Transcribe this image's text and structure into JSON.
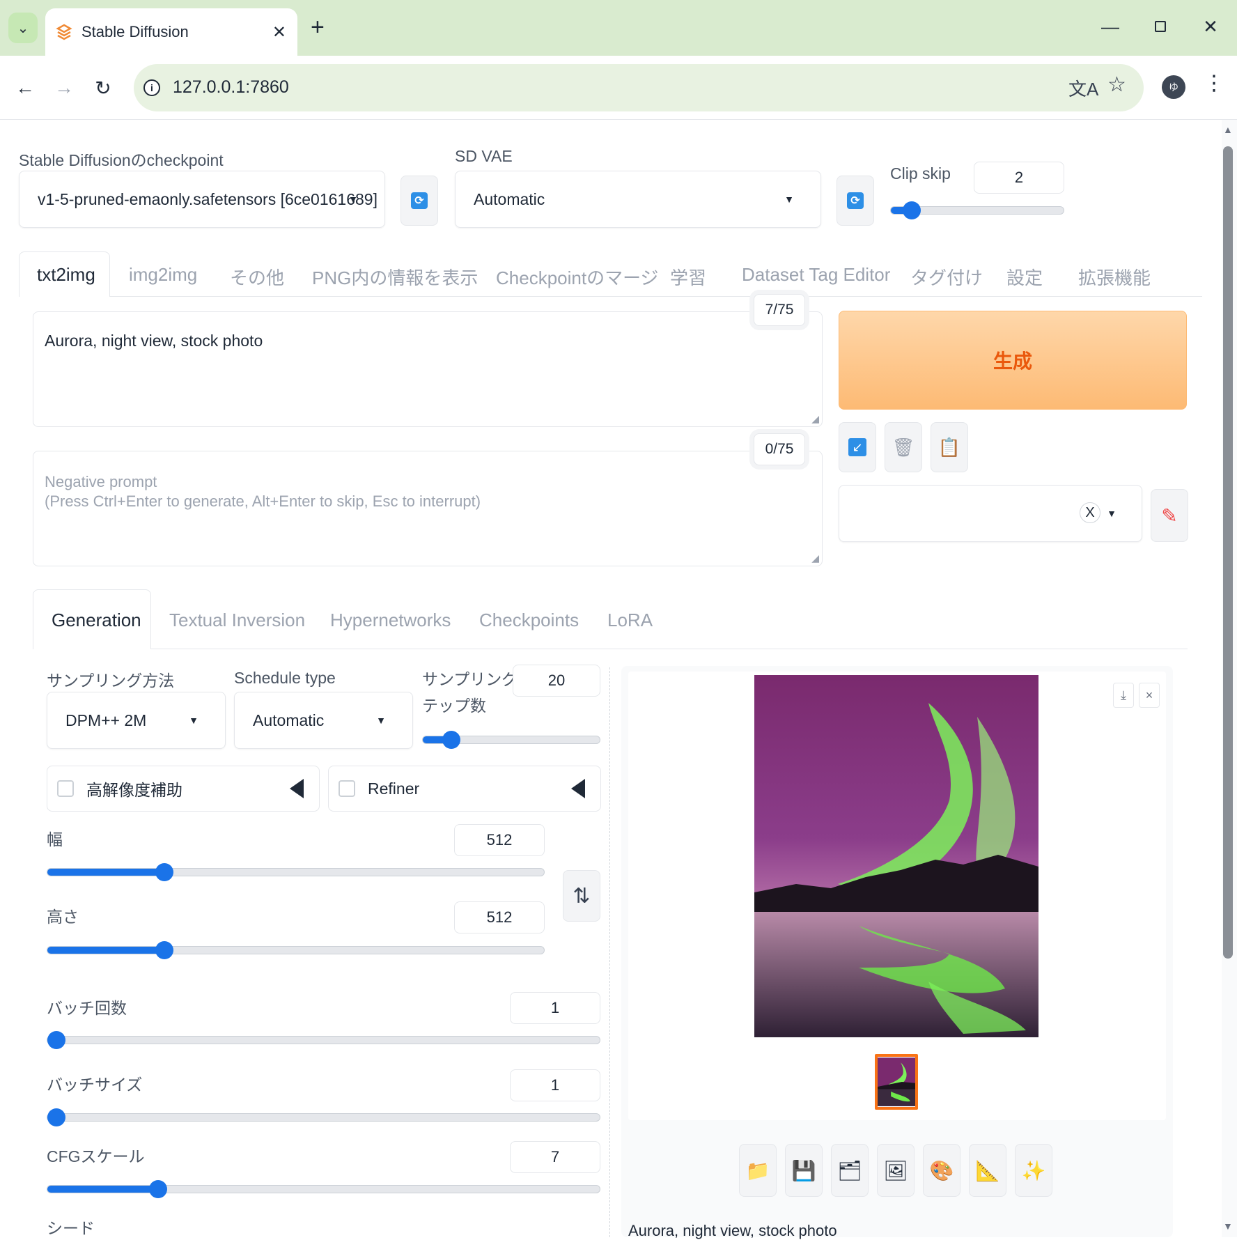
{
  "browser": {
    "tab_title": "Stable Diffusion",
    "url": "127.0.0.1:7860",
    "profile_initial": "ゆ"
  },
  "settings": {
    "checkpoint_label": "Stable Diffusionのcheckpoint",
    "checkpoint_value": "v1-5-pruned-emaonly.safetensors [6ce0161689]",
    "vae_label": "SD VAE",
    "vae_value": "Automatic",
    "clip_skip_label": "Clip skip",
    "clip_skip_value": "2",
    "clip_skip_fraction": 0.12
  },
  "main_tabs": [
    "txt2img",
    "img2img",
    "その他",
    "PNG内の情報を表示",
    "Checkpointのマージ",
    "学習",
    "Dataset Tag Editor",
    "タグ付け",
    "設定",
    "拡張機能"
  ],
  "prompt": {
    "value": "Aurora, night view, stock photo",
    "counter": "7/75"
  },
  "negative_prompt": {
    "placeholder_line1": "Negative prompt",
    "placeholder_line2": "(Press Ctrl+Enter to generate, Alt+Enter to skip, Esc to interrupt)",
    "counter": "0/75"
  },
  "generate_label": "生成",
  "style_close": "X",
  "sub_tabs": [
    "Generation",
    "Textual Inversion",
    "Hypernetworks",
    "Checkpoints",
    "LoRA"
  ],
  "generation": {
    "sampler_label": "サンプリング方法",
    "sampler_value": "DPM++ 2M",
    "schedule_label": "Schedule type",
    "schedule_value": "Automatic",
    "steps_label_line1": "サンプリングス",
    "steps_label_line2": "テップ数",
    "steps_value": "20",
    "steps_fraction": 0.16,
    "hires_label": "高解像度補助",
    "refiner_label": "Refiner",
    "width_label": "幅",
    "width_value": "512",
    "width_fraction": 0.235,
    "height_label": "高さ",
    "height_value": "512",
    "height_fraction": 0.235,
    "batch_count_label": "バッチ回数",
    "batch_count_value": "1",
    "batch_count_fraction": 0.0,
    "batch_size_label": "バッチサイズ",
    "batch_size_value": "1",
    "batch_size_fraction": 0.0,
    "cfg_label": "CFGスケール",
    "cfg_value": "7",
    "cfg_fraction": 0.2,
    "seed_label": "シード"
  },
  "output": {
    "caption": "Aurora, night view, stock photo",
    "close": "×"
  },
  "colors": {
    "accent": "#1a73e8",
    "generate_text": "#ea580c",
    "generate_bg_top": "#fed7aa",
    "generate_bg_bottom": "#fdba74"
  }
}
